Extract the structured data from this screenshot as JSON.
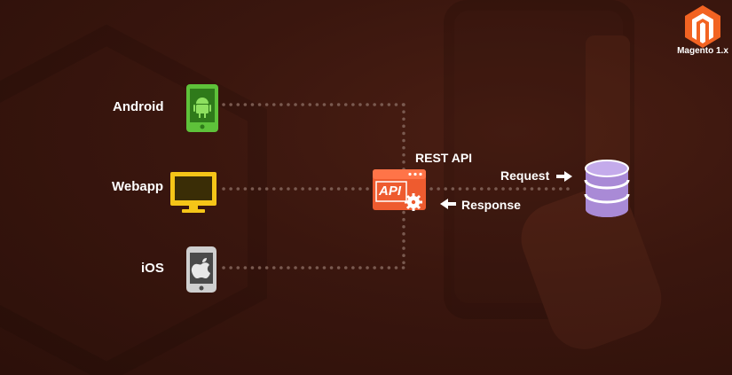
{
  "brand": {
    "logo_text": "Magento 1.x",
    "logo_color": "#f26322"
  },
  "clients": [
    {
      "name": "Android",
      "icon": "android-phone-icon",
      "color": "#5ec23a"
    },
    {
      "name": "Webapp",
      "icon": "monitor-icon",
      "color": "#f5c518"
    },
    {
      "name": "iOS",
      "icon": "iphone-icon",
      "color": "#cfcfcf"
    }
  ],
  "api": {
    "label": "REST API",
    "badge": "API",
    "color": "#ee5b2f"
  },
  "flow": {
    "request_label": "Request",
    "response_label": "Response"
  },
  "database": {
    "icon": "database-icon",
    "color": "#a98ad6"
  }
}
